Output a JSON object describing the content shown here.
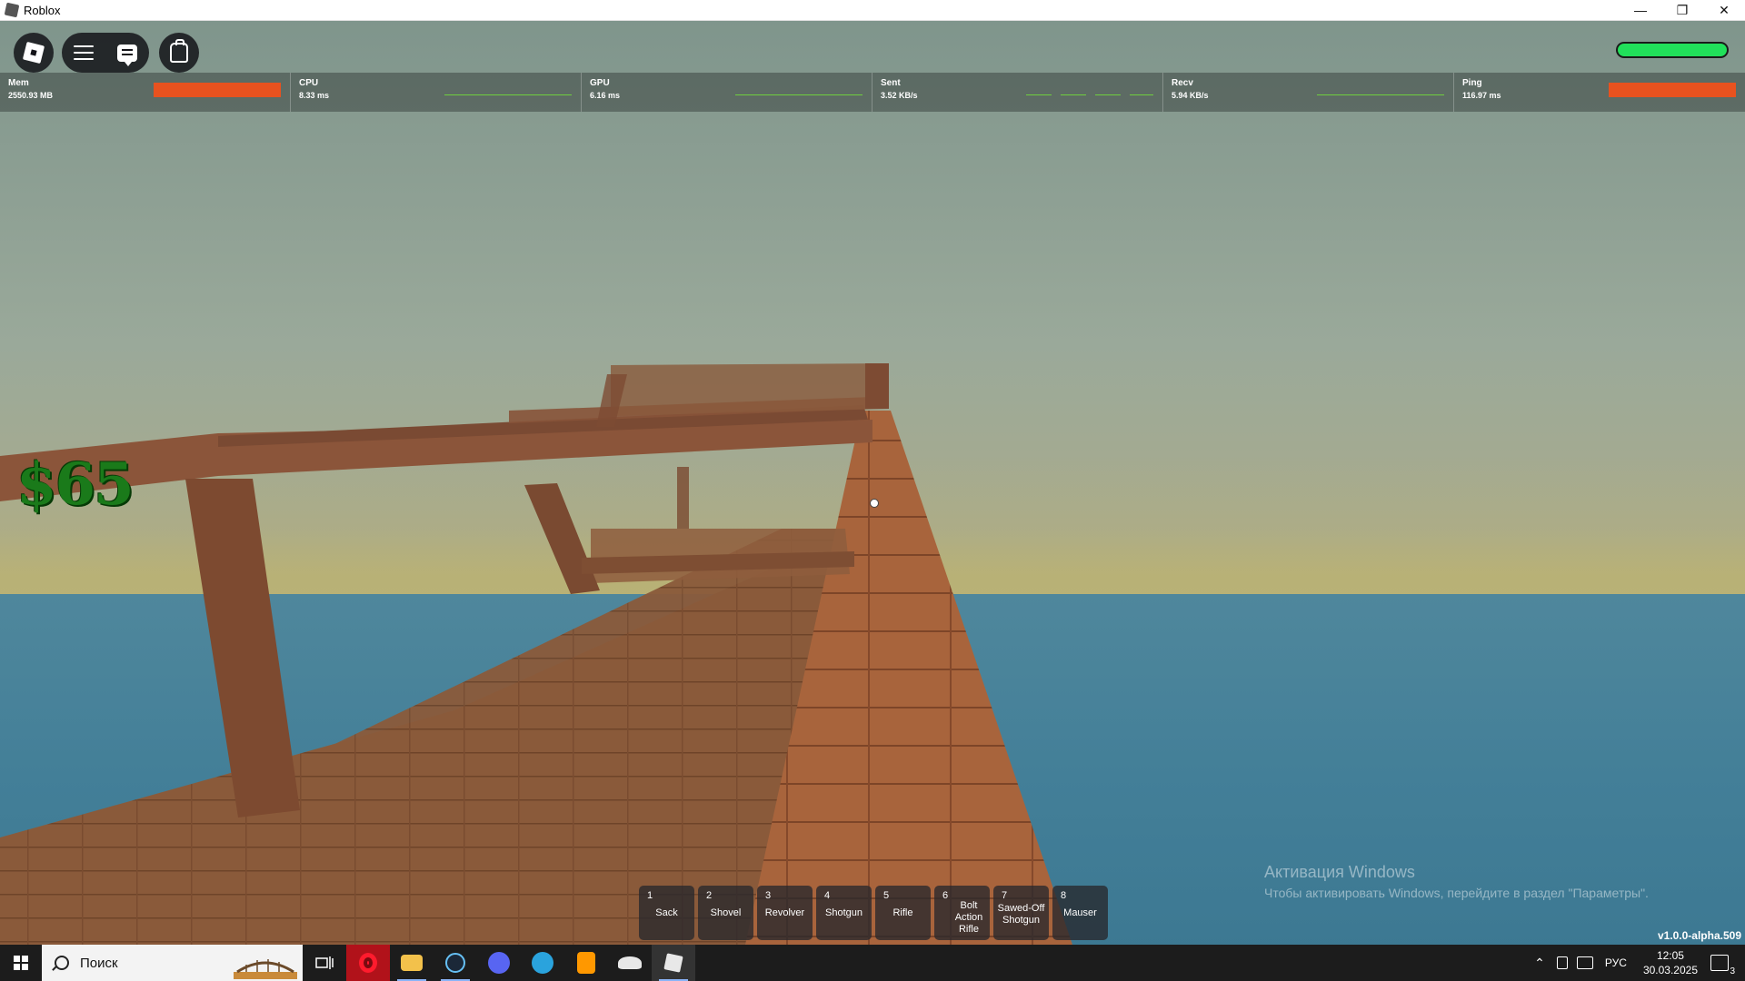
{
  "window": {
    "title": "Roblox",
    "minimize": "—",
    "restore": "❐",
    "close": "✕"
  },
  "hud": {
    "money": "$65",
    "health_fraction": 1.0,
    "version": "v1.0.0-alpha.509"
  },
  "stats": [
    {
      "label": "Mem",
      "value": "2550.93 MB"
    },
    {
      "label": "CPU",
      "value": "8.33 ms"
    },
    {
      "label": "GPU",
      "value": "6.16 ms"
    },
    {
      "label": "Sent",
      "value": "3.52 KB/s"
    },
    {
      "label": "Recv",
      "value": "5.94 KB/s"
    },
    {
      "label": "Ping",
      "value": "116.97 ms"
    }
  ],
  "hotbar": [
    {
      "num": "1",
      "name": "Sack"
    },
    {
      "num": "2",
      "name": "Shovel"
    },
    {
      "num": "3",
      "name": "Revolver"
    },
    {
      "num": "4",
      "name": "Shotgun"
    },
    {
      "num": "5",
      "name": "Rifle"
    },
    {
      "num": "6",
      "name": "Bolt Action Rifle"
    },
    {
      "num": "7",
      "name": "Sawed-Off Shotgun"
    },
    {
      "num": "8",
      "name": "Mauser"
    }
  ],
  "activation": {
    "title": "Активация Windows",
    "subtitle": "Чтобы активировать Windows, перейдите в раздел \"Параметры\"."
  },
  "taskbar": {
    "search_placeholder": "Поиск",
    "language": "РУС",
    "time": "12:05",
    "date": "30.03.2025",
    "notification_count": "3"
  },
  "colors": {
    "health": "#21e05a",
    "stat_alert_bar": "#e8521f",
    "money": "#1a7a1a"
  }
}
